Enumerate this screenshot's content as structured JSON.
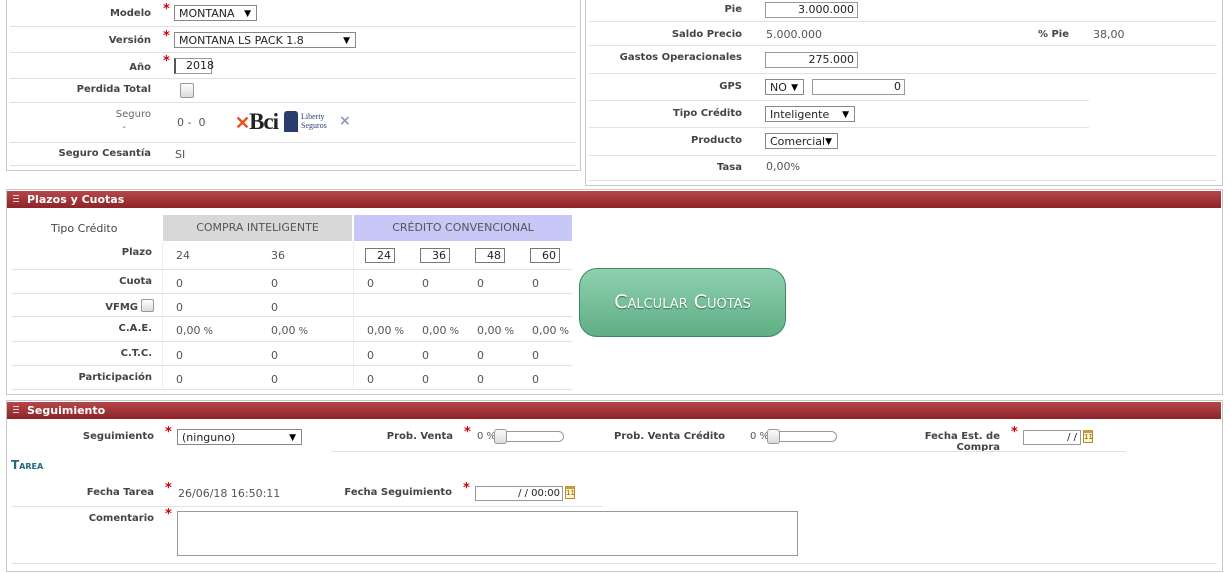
{
  "vehicle": {
    "modelo_label": "Modelo",
    "modelo_value": "MONTANA",
    "version_label": "Versión",
    "version_value": "MONTANA LS PACK 1.8",
    "anio_label": "Año",
    "anio_value": "2018",
    "perdida_label": "Perdida Total",
    "seguro_label": "Seguro",
    "seguro_dash": "-",
    "seguro_value": "0 -  0",
    "seguro_cesantia_label": "Seguro Cesantía",
    "seguro_cesantia_value": "SI",
    "bci_logo_text": "Bci",
    "liberty_line1": "Liberty",
    "liberty_line2": "Seguros",
    "close_glyph": "×"
  },
  "financing": {
    "pie_label": "Pie",
    "pie_value": "3.000.000",
    "saldo_label": "Saldo Precio",
    "saldo_value": "5.000.000",
    "pct_pie_label": "% Pie",
    "pct_pie_value": "38,00",
    "gastos_label": "Gastos Operacionales",
    "gastos_value": "275.000",
    "gps_label": "GPS",
    "gps_value": "NO",
    "gps_amount": "0",
    "tipo_credito_label": "Tipo Crédito",
    "tipo_credito_value": "Inteligente",
    "producto_label": "Producto",
    "producto_value": "Comercial",
    "tasa_label": "Tasa",
    "tasa_value": "0,00",
    "tasa_unit": "%"
  },
  "plazos": {
    "header": "Plazos y Cuotas",
    "tipo_credito_label": "Tipo Crédito",
    "col_compra": "COMPRA INTELIGENTE",
    "col_credito": "CRÉDITO CONVENCIONAL",
    "calc_button": "Calcular Cuotas",
    "rows": [
      {
        "label": "Plazo",
        "values": [
          "24",
          "36",
          "24",
          "36",
          "48",
          "60"
        ]
      },
      {
        "label": "Cuota",
        "values": [
          "0",
          "0",
          "0",
          "0",
          "0",
          "0"
        ]
      },
      {
        "label": "VFMG",
        "values": [
          "0",
          "0"
        ]
      },
      {
        "label": "C.A.E.",
        "values": [
          "0,00",
          "0,00",
          "0,00",
          "0,00",
          "0,00",
          "0,00"
        ],
        "unit": "%"
      },
      {
        "label": "C.T.C.",
        "values": [
          "0",
          "0",
          "0",
          "0",
          "0",
          "0"
        ]
      },
      {
        "label": "Participación",
        "values": [
          "0",
          "0",
          "0",
          "0",
          "0",
          "0"
        ]
      }
    ]
  },
  "seguimiento": {
    "header": "Seguimiento",
    "seguimiento_label": "Seguimiento",
    "seguimiento_value": "(ninguno)",
    "prob_venta_label": "Prob. Venta",
    "prob_venta_value": "0 %",
    "prob_venta_credito_label": "Prob. Venta Crédito",
    "prob_venta_credito_value": "0 %",
    "fecha_compra_label": "Fecha Est. de Compra",
    "fecha_compra_value": "/ /",
    "tarea_title": "Tarea",
    "fecha_tarea_label": "Fecha Tarea",
    "fecha_tarea_value": "26/06/18 16:50:11",
    "fecha_seguimiento_label": "Fecha Seguimiento",
    "fecha_seguimiento_value": "/ /  00:00",
    "comentario_label": "Comentario",
    "comentario_value": "",
    "calendar_glyph": "11"
  }
}
